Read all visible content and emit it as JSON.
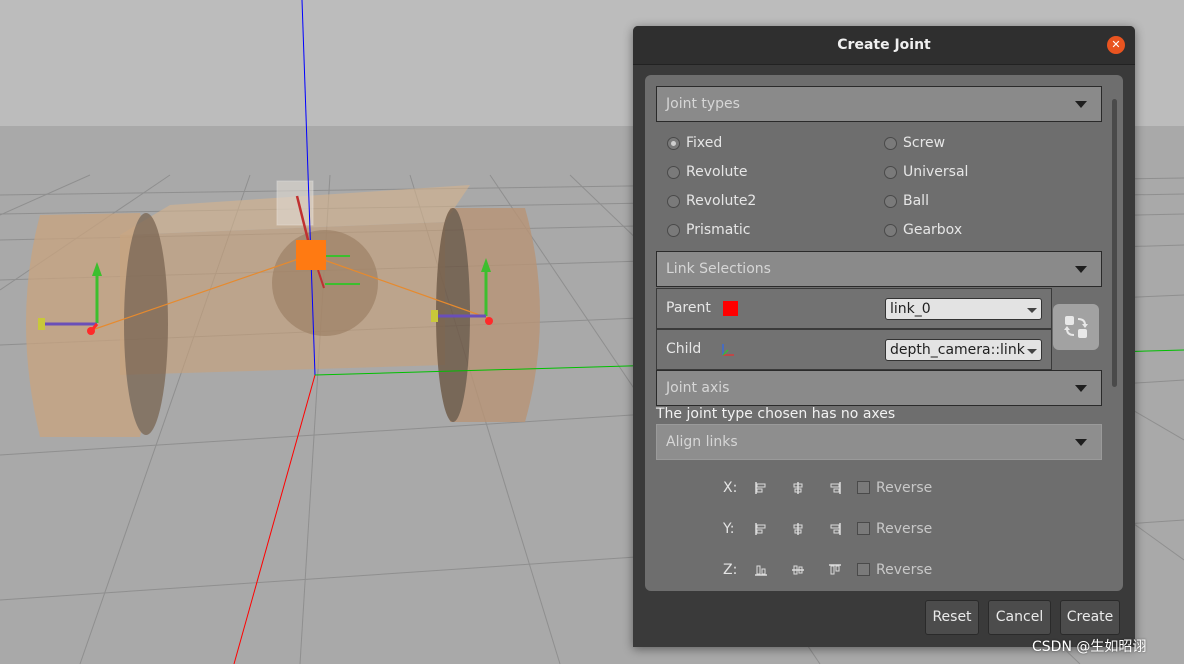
{
  "dialog": {
    "title": "Create Joint",
    "close_icon": "close-icon"
  },
  "sections": {
    "joint_types": "Joint types",
    "link_selections": "Link Selections",
    "joint_axis": "Joint axis",
    "align_links": "Align links"
  },
  "joint_types": [
    {
      "label": "Fixed",
      "selected": true
    },
    {
      "label": "Screw",
      "selected": false
    },
    {
      "label": "Revolute",
      "selected": false
    },
    {
      "label": "Universal",
      "selected": false
    },
    {
      "label": "Revolute2",
      "selected": false
    },
    {
      "label": "Ball",
      "selected": false
    },
    {
      "label": "Prismatic",
      "selected": false
    },
    {
      "label": "Gearbox",
      "selected": false
    }
  ],
  "links": {
    "parent_label": "Parent",
    "parent_value": "link_0",
    "parent_color": "#ff0000",
    "child_label": "Child",
    "child_value": "depth_camera::link",
    "swap_icon": "swap-icon"
  },
  "joint_axis_message": "The joint type chosen has no axes",
  "align": {
    "rows": [
      {
        "axis": "X:",
        "reverse": "Reverse",
        "checked": false
      },
      {
        "axis": "Y:",
        "reverse": "Reverse",
        "checked": false
      },
      {
        "axis": "Z:",
        "reverse": "Reverse",
        "checked": false
      }
    ]
  },
  "buttons": {
    "reset": "Reset",
    "cancel": "Cancel",
    "create": "Create"
  },
  "watermark": "CSDN @生如昭诩",
  "colors": {
    "close_button": "#e95420",
    "x_axis": "#ff0000",
    "y_axis": "#00c000",
    "z_axis": "#0000ff",
    "link_body": "#c8a882"
  }
}
